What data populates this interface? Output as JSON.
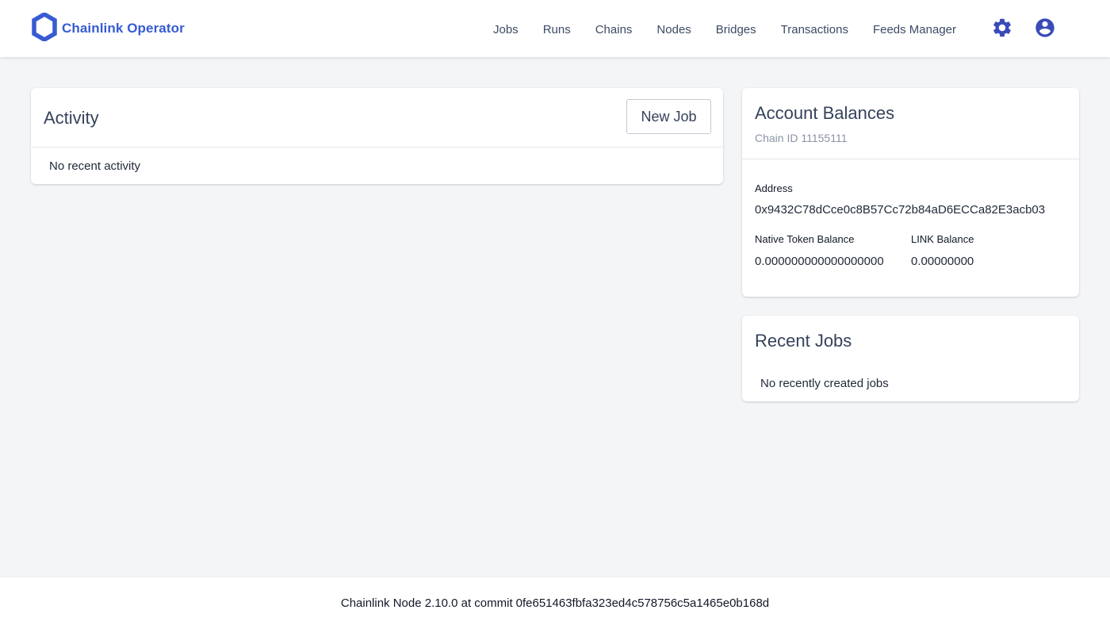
{
  "header": {
    "brand": "Chainlink Operator",
    "brand_color": "#375bd2",
    "nav": [
      "Jobs",
      "Runs",
      "Chains",
      "Nodes",
      "Bridges",
      "Transactions",
      "Feeds Manager"
    ],
    "icons": [
      "gear-icon",
      "account-circle-icon"
    ]
  },
  "activity": {
    "title": "Activity",
    "new_job_label": "New Job",
    "empty_text": "No recent activity"
  },
  "account_balances": {
    "title": "Account Balances",
    "chain_id": "Chain ID 11155111",
    "address_label": "Address",
    "address": "0x9432C78dCce0c8B57Cc72b84aD6ECCa82E3acb03",
    "native_label": "Native Token Balance",
    "native_value": "0.000000000000000000",
    "link_label": "LINK Balance",
    "link_value": "0.00000000"
  },
  "recent_jobs": {
    "title": "Recent Jobs",
    "empty_text": "No recently created jobs"
  },
  "footer": {
    "prefix": "Chainlink Node 2.10.0 at commit",
    "commit": "0fe651463fbfa323ed4c578756c5a1465e0b168d"
  }
}
